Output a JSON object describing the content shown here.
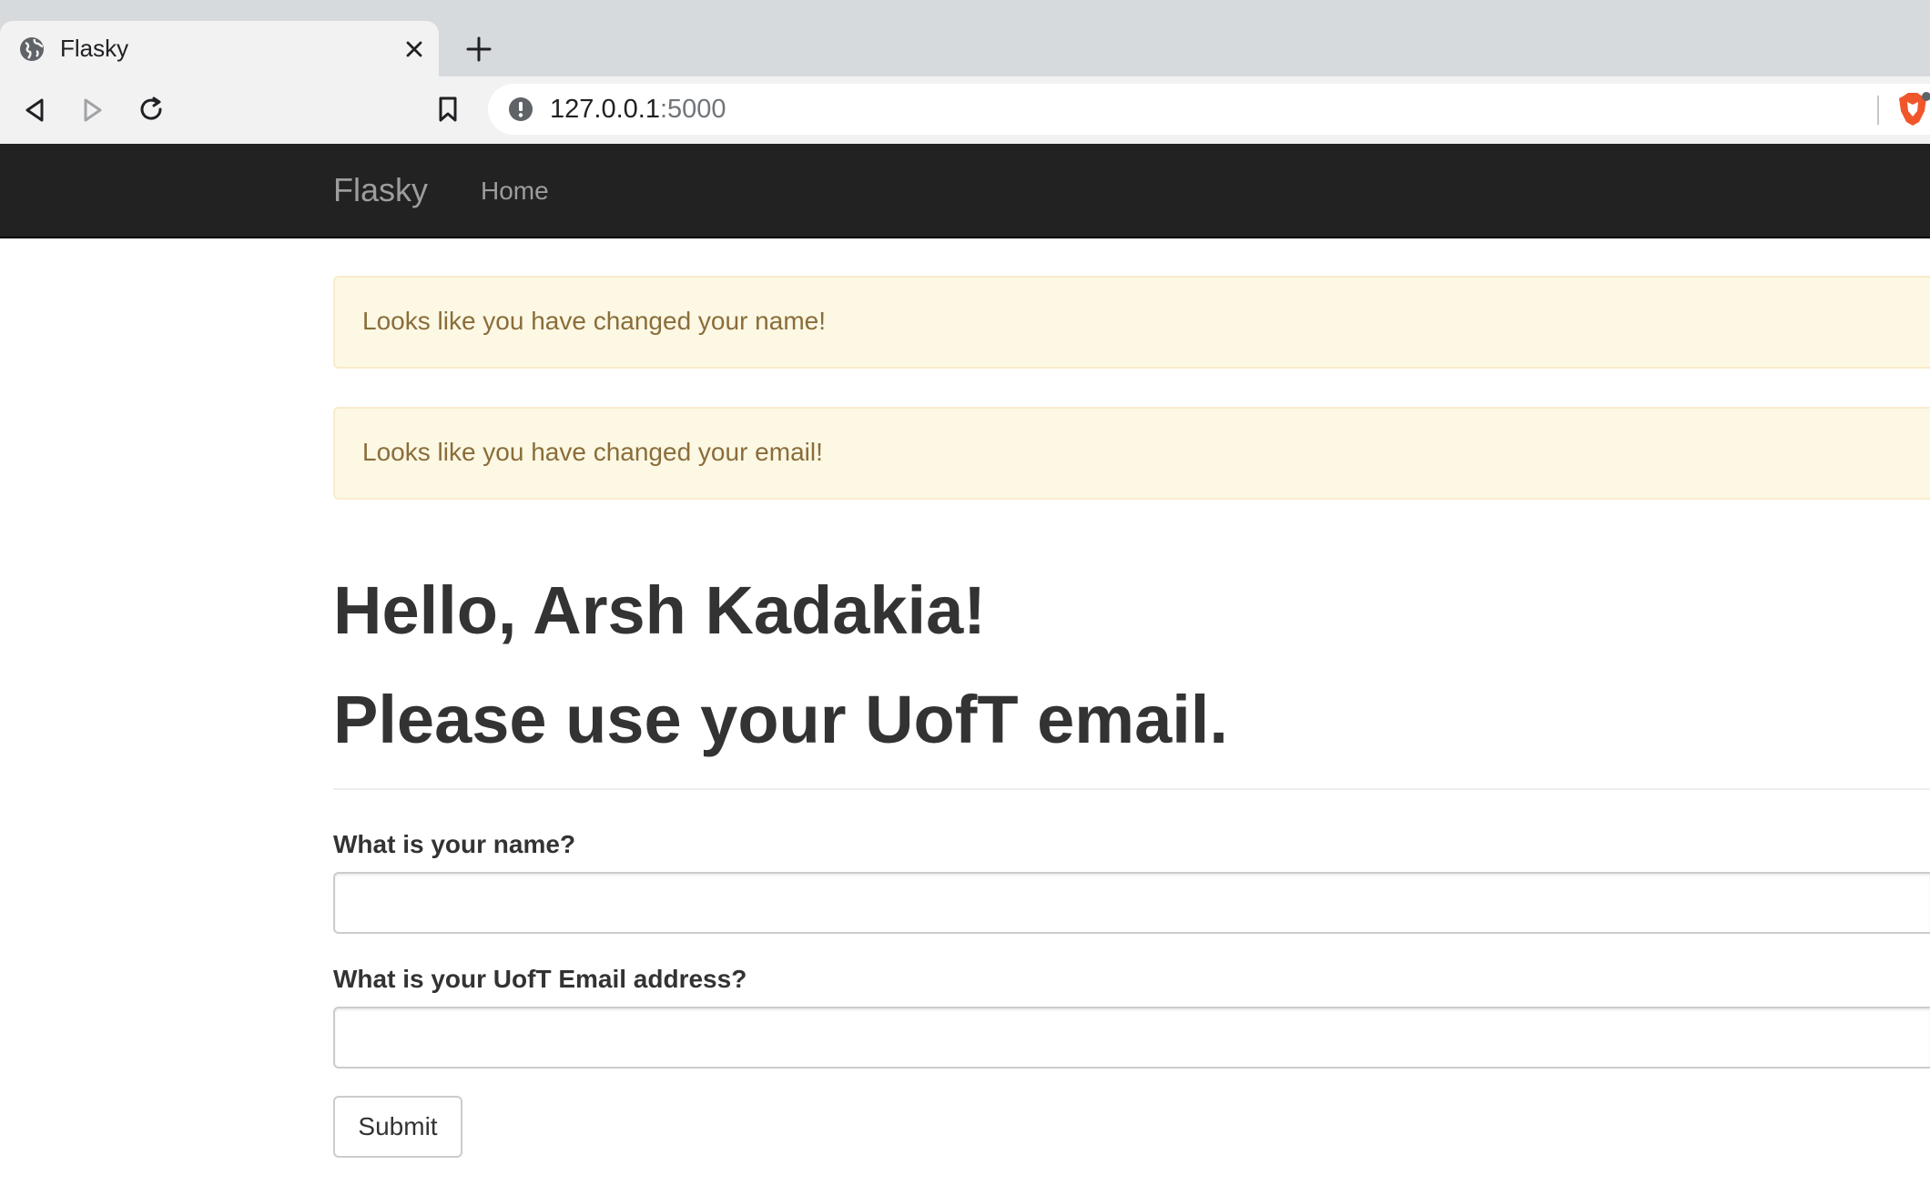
{
  "browser": {
    "tab_title": "Flasky",
    "url_host": "127.0.0.1",
    "url_port": ":5000",
    "icons": [
      "globe-icon",
      "close-icon",
      "plus-icon",
      "back-icon",
      "forward-icon",
      "reload-icon",
      "bookmark-icon",
      "info-icon",
      "brave-lion-icon"
    ]
  },
  "navbar": {
    "brand": "Flasky",
    "links": [
      {
        "label": "Home"
      }
    ],
    "background_color": "#222222",
    "text_color": "#9d9d9d"
  },
  "alerts": [
    {
      "message": "Looks like you have changed your name!"
    },
    {
      "message": "Looks like you have changed your email!"
    }
  ],
  "page": {
    "greeting": "Hello, Arsh Kadakia!",
    "notice": "Please use your UofT email."
  },
  "form": {
    "name_label": "What is your name?",
    "name_value": "",
    "email_label": "What is your UofT Email address?",
    "email_value": "",
    "submit_label": "Submit"
  },
  "colors": {
    "alert_background": "#fcf8e3",
    "alert_border": "#faebcc",
    "alert_text": "#8a6d3b",
    "heading_text": "#333333"
  }
}
